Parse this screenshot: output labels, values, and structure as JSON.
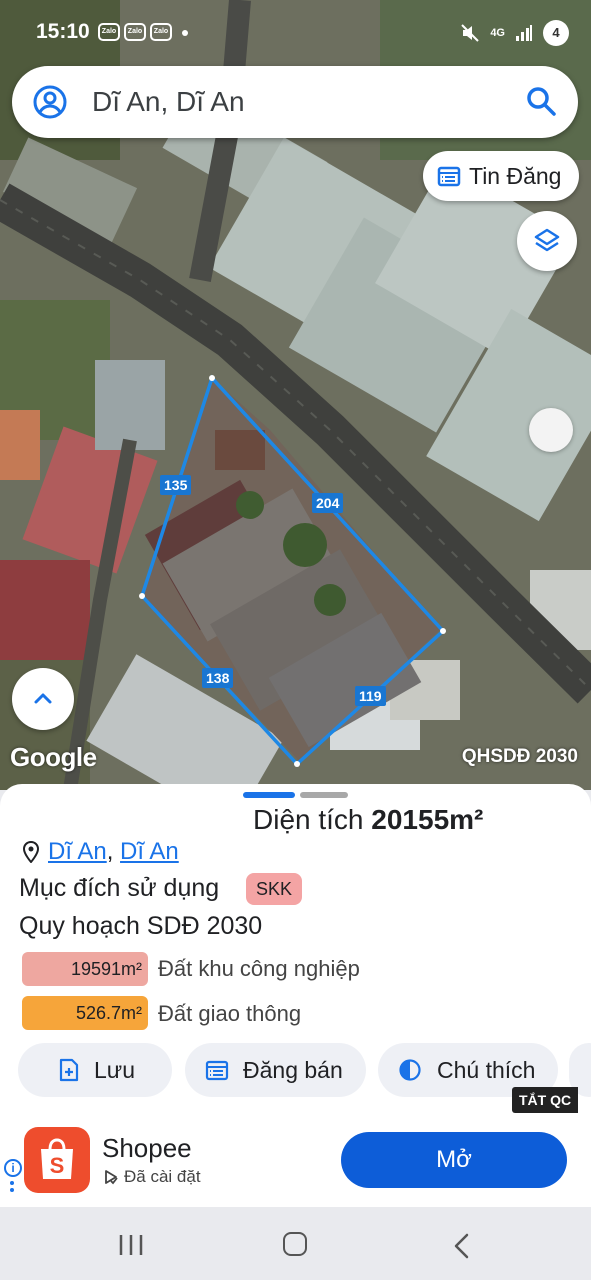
{
  "status": {
    "time": "15:10",
    "notifications": [
      "Zalo",
      "Zalo",
      "Zalo"
    ],
    "network": "4G",
    "battery": "4"
  },
  "search": {
    "query": "Dĩ An, Dĩ An"
  },
  "map": {
    "tin_dang_label": "Tin Đăng",
    "edge_labels": [
      "135",
      "204",
      "138",
      "119"
    ],
    "attribution": "Google",
    "layer_name": "QHSDĐ 2030",
    "parcel_color": "#1e88e5"
  },
  "sheet": {
    "area_prefix": "Diện tích",
    "area_value": "20155m²",
    "location": {
      "part1": "Dĩ An",
      "separator": ", ",
      "part2": "Dĩ An"
    },
    "purpose_label": "Mục đích sử dụng",
    "purpose_badge": "SKK",
    "plan_label": "Quy hoạch SDĐ 2030",
    "zones": [
      {
        "area": "19591m²",
        "label": "Đất khu công nghiệp",
        "color": "#eea7a0"
      },
      {
        "area": "526.7m²",
        "label": "Đất giao thông",
        "color": "#f6a53a"
      }
    ],
    "actions": {
      "save": "Lưu",
      "sell": "Đăng bán",
      "legend": "Chú thích"
    },
    "ad_tag": "TẮT QC"
  },
  "ad": {
    "app_name": "Shopee",
    "status": "Đã cài đặt",
    "open_label": "Mở",
    "brand_color": "#ee4d2d"
  }
}
